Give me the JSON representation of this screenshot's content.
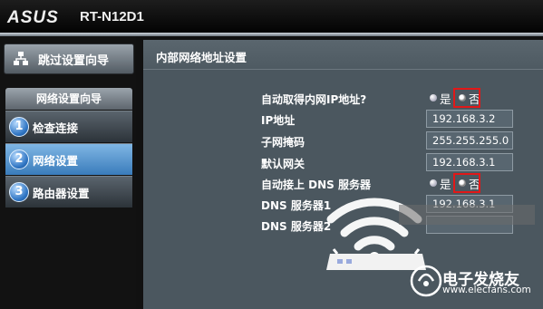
{
  "header": {
    "brand": "ASUS",
    "model": "RT-N12D1"
  },
  "sidebar": {
    "skip_wizard": "跳过设置向导",
    "section_title": "网络设置向导",
    "items": [
      {
        "num": "1",
        "label": "检查连接",
        "active": false
      },
      {
        "num": "2",
        "label": "网络设置",
        "active": true
      },
      {
        "num": "3",
        "label": "路由器设置",
        "active": false
      }
    ]
  },
  "main": {
    "title": "内部网络地址设置",
    "auto_ip": {
      "label": "自动取得内网IP地址?",
      "yes": "是",
      "no": "否",
      "selected": "否"
    },
    "ip": {
      "label": "IP地址",
      "value": "192.168.3.2"
    },
    "mask": {
      "label": "子网掩码",
      "value": "255.255.255.0"
    },
    "gateway": {
      "label": "默认网关",
      "value": "192.168.3.1"
    },
    "auto_dns": {
      "label": "自动接上 DNS 服务器",
      "yes": "是",
      "no": "否",
      "selected": "否"
    },
    "dns1": {
      "label": "DNS 服务器1",
      "value": "192.168.3.1"
    },
    "dns2": {
      "label": "DNS 服务器2",
      "value": ""
    }
  },
  "watermark": {
    "name": "电子发烧友",
    "url": "www.elecfans.com"
  },
  "colors": {
    "accent": "#3a7cbb",
    "highlight": "#e21818",
    "panel": "#4b575f"
  }
}
